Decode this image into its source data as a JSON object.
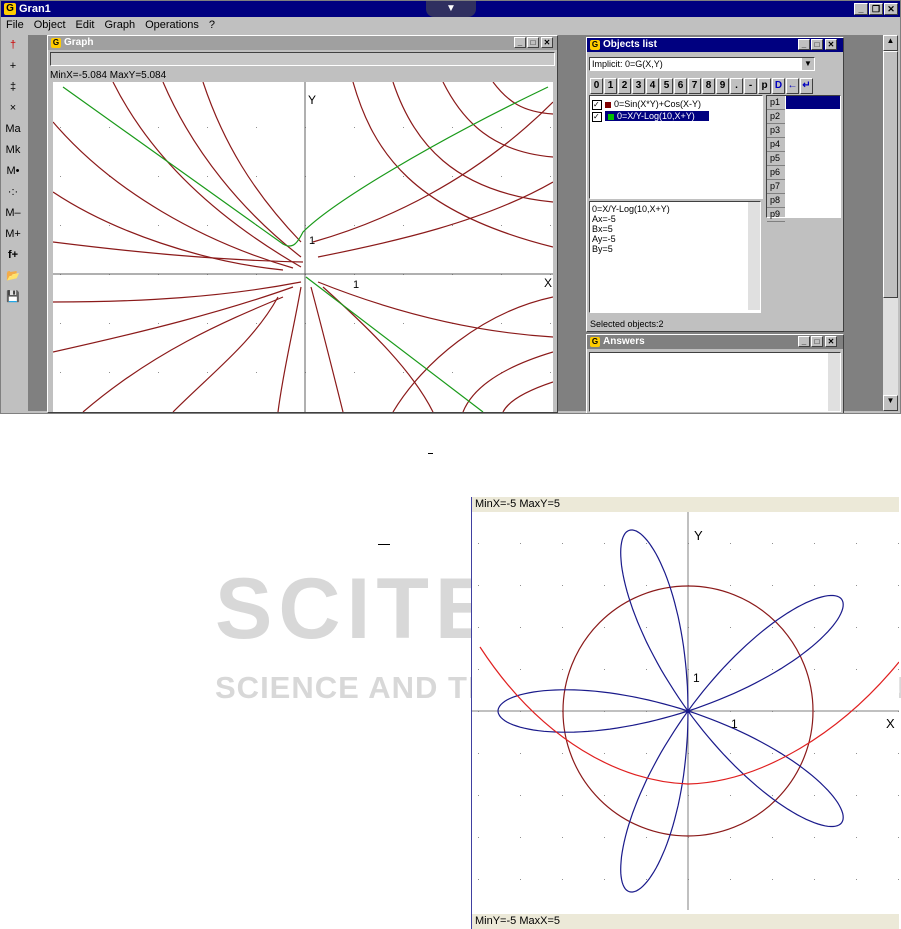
{
  "app": {
    "title": "Gran1",
    "menu": [
      "File",
      "Object",
      "Edit",
      "Graph",
      "Operations",
      "?"
    ],
    "toolbar": [
      "†",
      "+",
      "‡",
      "×",
      "Ma",
      "Mk",
      "M•",
      "·:·",
      "M–",
      "M+",
      "f+",
      "📂",
      "💾"
    ]
  },
  "graph_window": {
    "title": "Graph",
    "status": "MinX=-5.084  MaxY=5.084",
    "axis_x": "X",
    "axis_y": "Y",
    "tick_x": "1",
    "tick_y": "1"
  },
  "objects_window": {
    "title": "Objects list",
    "dropdown": "Implicit: 0=G(X,Y)",
    "keys": [
      "0",
      "1",
      "2",
      "3",
      "4",
      "5",
      "6",
      "7",
      "8",
      "9",
      ".",
      "-",
      "p",
      "D",
      "←",
      "↵"
    ],
    "objects": [
      {
        "label": "0=Sin(X*Y)+Cos(X-Y)",
        "color": "#800000",
        "selected": false
      },
      {
        "label": "0=X/Y-Log(10,X+Y)",
        "color": "#008000",
        "selected": true
      }
    ],
    "params": [
      "p1",
      "p2",
      "p3",
      "p4",
      "p5",
      "p6",
      "p7",
      "p8",
      "p9"
    ],
    "info_lines": [
      "0=X/Y-Log(10,X+Y)",
      "Ax=-5",
      "Bx=5",
      "Ay=-5",
      "By=5"
    ],
    "status": "Selected objects:2"
  },
  "answers_window": {
    "title": "Answers"
  },
  "second_plot": {
    "top_status": "MinX=-5  MaxY=5",
    "bottom_status": "MinY=-5  MaxX=5",
    "axis_x": "X",
    "axis_y": "Y",
    "tick_x": "1",
    "tick_y": "1"
  },
  "watermark": {
    "line1": "SCITEPRESS",
    "line2": "SCIENCE AND TECHNOLOGY PUBLICATIONS"
  },
  "colors": {
    "curve_red": "#8b1a1a",
    "curve_green": "#1a9a1a",
    "curve_blue": "#1a1a8b",
    "curve_bright_red": "#e02020",
    "title_active": "#000080"
  }
}
